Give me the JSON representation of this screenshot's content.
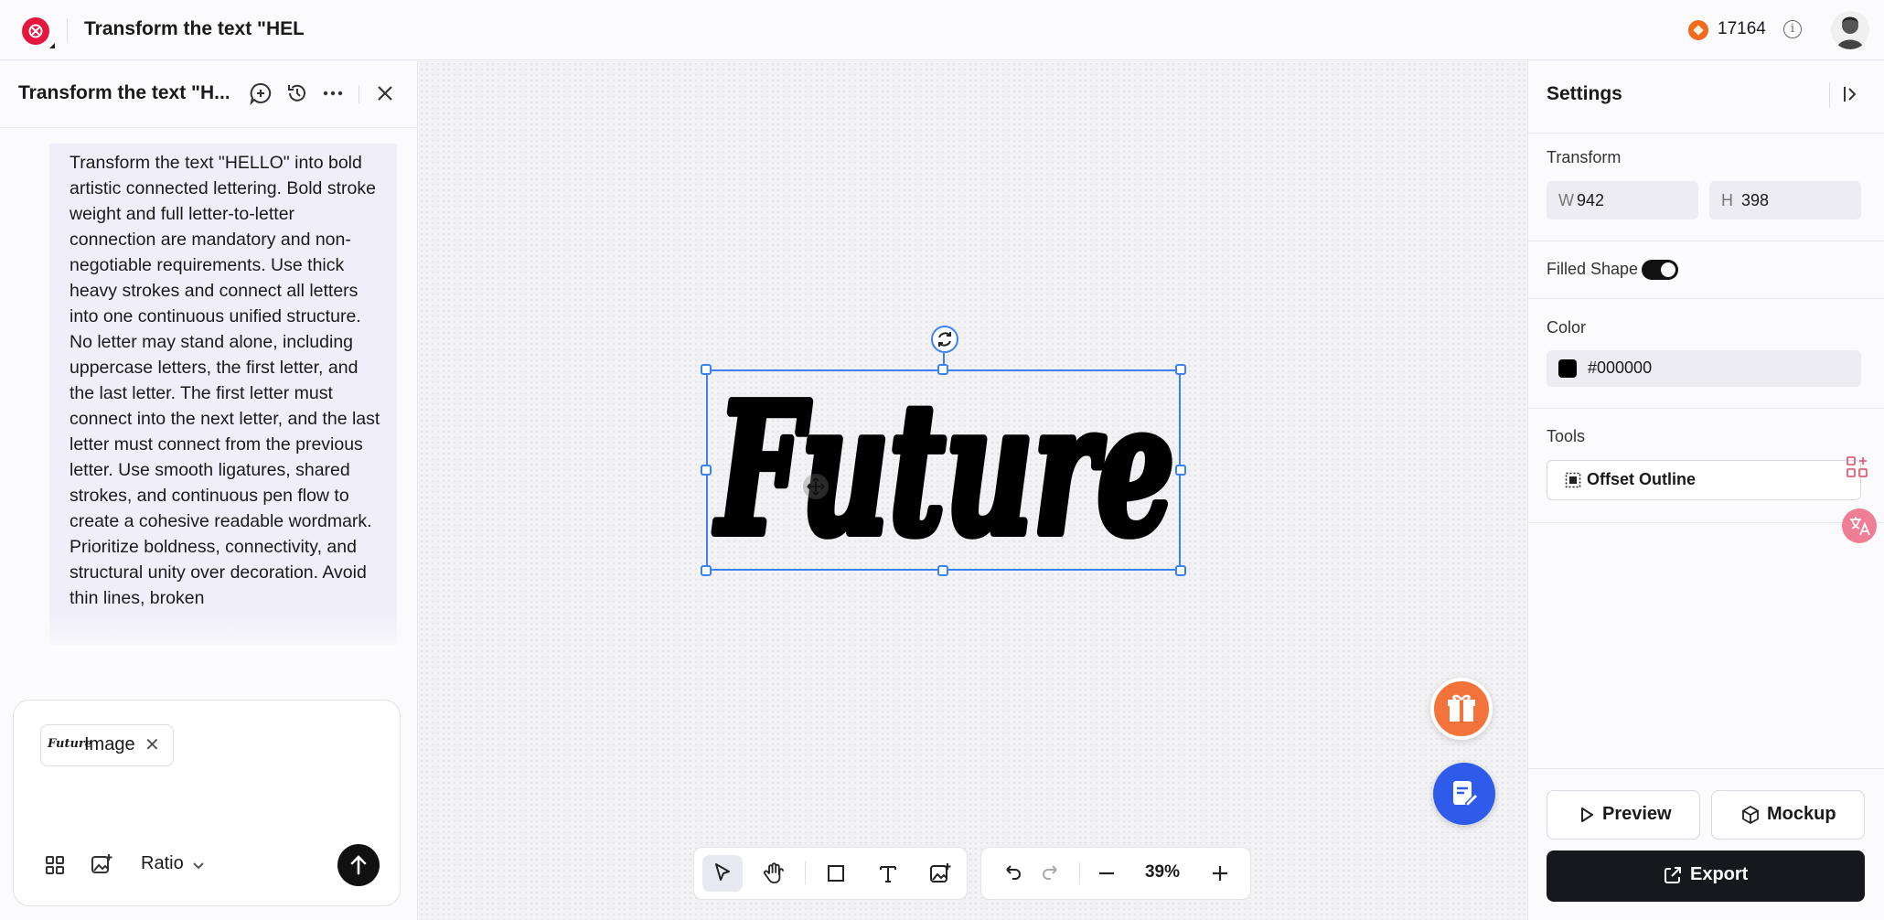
{
  "topbar": {
    "doc_title": "Transform the text \"HELL",
    "credits": "17164",
    "info": "i"
  },
  "left_panel": {
    "title": "Transform the text \"H...",
    "prompt": "Transform the text \"HELLO\" into bold artistic connected lettering. Bold stroke weight and full letter-to-letter connection are mandatory and non-negotiable requirements. Use thick heavy strokes and connect all letters into one continuous unified structure. No letter may stand alone, including uppercase letters, the first letter, and the last letter. The first letter must connect into the next letter, and the last letter must connect from the previous letter. Use smooth ligatures, shared strokes, and continuous pen flow to create a cohesive readable wordmark. Prioritize boldness, connectivity, and structural unity over decoration. Avoid thin lines, broken",
    "attachment": {
      "thumb_text": "Future",
      "label": "Image",
      "remove": "✕"
    },
    "ratio_label": "Ratio"
  },
  "canvas": {
    "wordmark": "Future",
    "zoom": "39%"
  },
  "settings": {
    "title": "Settings",
    "transform_label": "Transform",
    "w_prefix": "W",
    "w_value": "942",
    "h_prefix": "H",
    "h_value": "398",
    "filled_shape_label": "Filled Shape",
    "filled_shape_on": true,
    "color_label": "Color",
    "color_value": "#000000",
    "tools_label": "Tools",
    "tool_button": "Offset Outline",
    "preview": "Preview",
    "mockup": "Mockup",
    "export": "Export"
  },
  "colors": {
    "brand": "#e5173f",
    "selection": "#3b82f6",
    "gift": "#f4733a",
    "notes": "#2f5bea",
    "export_bg": "#16181d"
  }
}
